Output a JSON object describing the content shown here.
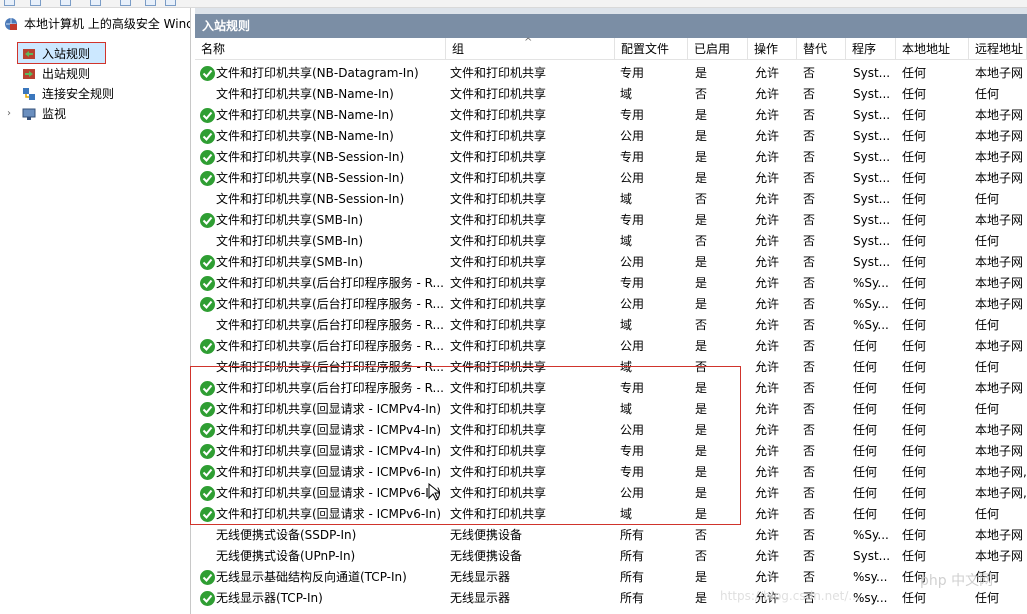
{
  "tree": {
    "root_label": "本地计算机 上的高级安全 Winc",
    "items": [
      {
        "label": "入站规则",
        "icon": "inbound-rules-icon"
      },
      {
        "label": "出站规则",
        "icon": "outbound-rules-icon"
      },
      {
        "label": "连接安全规则",
        "icon": "connection-security-icon"
      },
      {
        "label": "监视",
        "icon": "monitor-icon"
      }
    ]
  },
  "pane": {
    "title": "入站规则",
    "columns": [
      "名称",
      "组",
      "配置文件",
      "已启用",
      "操作",
      "替代",
      "程序",
      "本地地址",
      "远程地址"
    ]
  },
  "rows": [
    {
      "enabled_icon": true,
      "name": "文件和打印机共享(NB-Datagram-In)",
      "group": "文件和打印机共享",
      "profile": "专用",
      "enabled": "是",
      "action": "允许",
      "override": "否",
      "program": "Syst...",
      "local": "任何",
      "remote": "本地子网"
    },
    {
      "enabled_icon": false,
      "name": "文件和打印机共享(NB-Name-In)",
      "group": "文件和打印机共享",
      "profile": "域",
      "enabled": "否",
      "action": "允许",
      "override": "否",
      "program": "Syst...",
      "local": "任何",
      "remote": "任何"
    },
    {
      "enabled_icon": true,
      "name": "文件和打印机共享(NB-Name-In)",
      "group": "文件和打印机共享",
      "profile": "专用",
      "enabled": "是",
      "action": "允许",
      "override": "否",
      "program": "Syst...",
      "local": "任何",
      "remote": "本地子网"
    },
    {
      "enabled_icon": true,
      "name": "文件和打印机共享(NB-Name-In)",
      "group": "文件和打印机共享",
      "profile": "公用",
      "enabled": "是",
      "action": "允许",
      "override": "否",
      "program": "Syst...",
      "local": "任何",
      "remote": "本地子网"
    },
    {
      "enabled_icon": true,
      "name": "文件和打印机共享(NB-Session-In)",
      "group": "文件和打印机共享",
      "profile": "专用",
      "enabled": "是",
      "action": "允许",
      "override": "否",
      "program": "Syst...",
      "local": "任何",
      "remote": "本地子网"
    },
    {
      "enabled_icon": true,
      "name": "文件和打印机共享(NB-Session-In)",
      "group": "文件和打印机共享",
      "profile": "公用",
      "enabled": "是",
      "action": "允许",
      "override": "否",
      "program": "Syst...",
      "local": "任何",
      "remote": "本地子网"
    },
    {
      "enabled_icon": false,
      "name": "文件和打印机共享(NB-Session-In)",
      "group": "文件和打印机共享",
      "profile": "域",
      "enabled": "否",
      "action": "允许",
      "override": "否",
      "program": "Syst...",
      "local": "任何",
      "remote": "任何"
    },
    {
      "enabled_icon": true,
      "name": "文件和打印机共享(SMB-In)",
      "group": "文件和打印机共享",
      "profile": "专用",
      "enabled": "是",
      "action": "允许",
      "override": "否",
      "program": "Syst...",
      "local": "任何",
      "remote": "本地子网"
    },
    {
      "enabled_icon": false,
      "name": "文件和打印机共享(SMB-In)",
      "group": "文件和打印机共享",
      "profile": "域",
      "enabled": "否",
      "action": "允许",
      "override": "否",
      "program": "Syst...",
      "local": "任何",
      "remote": "任何"
    },
    {
      "enabled_icon": true,
      "name": "文件和打印机共享(SMB-In)",
      "group": "文件和打印机共享",
      "profile": "公用",
      "enabled": "是",
      "action": "允许",
      "override": "否",
      "program": "Syst...",
      "local": "任何",
      "remote": "本地子网"
    },
    {
      "enabled_icon": true,
      "name": "文件和打印机共享(后台打印程序服务 - R...",
      "group": "文件和打印机共享",
      "profile": "专用",
      "enabled": "是",
      "action": "允许",
      "override": "否",
      "program": "%Sy...",
      "local": "任何",
      "remote": "本地子网"
    },
    {
      "enabled_icon": true,
      "name": "文件和打印机共享(后台打印程序服务 - R...",
      "group": "文件和打印机共享",
      "profile": "公用",
      "enabled": "是",
      "action": "允许",
      "override": "否",
      "program": "%Sy...",
      "local": "任何",
      "remote": "本地子网"
    },
    {
      "enabled_icon": false,
      "name": "文件和打印机共享(后台打印程序服务 - R...",
      "group": "文件和打印机共享",
      "profile": "域",
      "enabled": "否",
      "action": "允许",
      "override": "否",
      "program": "%Sy...",
      "local": "任何",
      "remote": "任何"
    },
    {
      "enabled_icon": true,
      "name": "文件和打印机共享(后台打印程序服务 - R...",
      "group": "文件和打印机共享",
      "profile": "公用",
      "enabled": "是",
      "action": "允许",
      "override": "否",
      "program": "任何",
      "local": "任何",
      "remote": "本地子网"
    },
    {
      "enabled_icon": false,
      "name": "文件和打印机共享(后台打印程序服务 - R...",
      "group": "文件和打印机共享",
      "profile": "域",
      "enabled": "否",
      "action": "允许",
      "override": "否",
      "program": "任何",
      "local": "任何",
      "remote": "任何"
    },
    {
      "enabled_icon": true,
      "name": "文件和打印机共享(后台打印程序服务 - R...",
      "group": "文件和打印机共享",
      "profile": "专用",
      "enabled": "是",
      "action": "允许",
      "override": "否",
      "program": "任何",
      "local": "任何",
      "remote": "本地子网"
    },
    {
      "enabled_icon": true,
      "name": "文件和打印机共享(回显请求 - ICMPv4-In)",
      "group": "文件和打印机共享",
      "profile": "域",
      "enabled": "是",
      "action": "允许",
      "override": "否",
      "program": "任何",
      "local": "任何",
      "remote": "任何"
    },
    {
      "enabled_icon": true,
      "name": "文件和打印机共享(回显请求 - ICMPv4-In)",
      "group": "文件和打印机共享",
      "profile": "公用",
      "enabled": "是",
      "action": "允许",
      "override": "否",
      "program": "任何",
      "local": "任何",
      "remote": "本地子网"
    },
    {
      "enabled_icon": true,
      "name": "文件和打印机共享(回显请求 - ICMPv4-In)",
      "group": "文件和打印机共享",
      "profile": "专用",
      "enabled": "是",
      "action": "允许",
      "override": "否",
      "program": "任何",
      "local": "任何",
      "remote": "本地子网"
    },
    {
      "enabled_icon": true,
      "name": "文件和打印机共享(回显请求 - ICMPv6-In)",
      "group": "文件和打印机共享",
      "profile": "专用",
      "enabled": "是",
      "action": "允许",
      "override": "否",
      "program": "任何",
      "local": "任何",
      "remote": "本地子网,"
    },
    {
      "enabled_icon": true,
      "name": "文件和打印机共享(回显请求 - ICMPv6-In)",
      "group": "文件和打印机共享",
      "profile": "公用",
      "enabled": "是",
      "action": "允许",
      "override": "否",
      "program": "任何",
      "local": "任何",
      "remote": "本地子网,"
    },
    {
      "enabled_icon": true,
      "name": "文件和打印机共享(回显请求 - ICMPv6-In)",
      "group": "文件和打印机共享",
      "profile": "域",
      "enabled": "是",
      "action": "允许",
      "override": "否",
      "program": "任何",
      "local": "任何",
      "remote": "任何"
    },
    {
      "enabled_icon": false,
      "name": "无线便携式设备(SSDP-In)",
      "group": "无线便携设备",
      "profile": "所有",
      "enabled": "否",
      "action": "允许",
      "override": "否",
      "program": "%Sy...",
      "local": "任何",
      "remote": "本地子网"
    },
    {
      "enabled_icon": false,
      "name": "无线便携式设备(UPnP-In)",
      "group": "无线便携设备",
      "profile": "所有",
      "enabled": "否",
      "action": "允许",
      "override": "否",
      "program": "Syst...",
      "local": "任何",
      "remote": "本地子网"
    },
    {
      "enabled_icon": true,
      "name": "无线显示基础结构反向通道(TCP-In)",
      "group": "无线显示器",
      "profile": "所有",
      "enabled": "是",
      "action": "允许",
      "override": "否",
      "program": "%sy...",
      "local": "任何",
      "remote": "任何"
    },
    {
      "enabled_icon": true,
      "name": "无线显示器(TCP-In)",
      "group": "无线显示器",
      "profile": "所有",
      "enabled": "是",
      "action": "允许",
      "override": "否",
      "program": "%sy...",
      "local": "任何",
      "remote": "任何"
    }
  ],
  "watermark": "php 中文网",
  "watermark2": "https://blog.csdn.net/...",
  "colors": {
    "title_bar": "#7b8ea5",
    "enabled_icon": "#2f9e33",
    "highlight_border": "#d0342c",
    "selected_bg": "#cce8ff"
  }
}
